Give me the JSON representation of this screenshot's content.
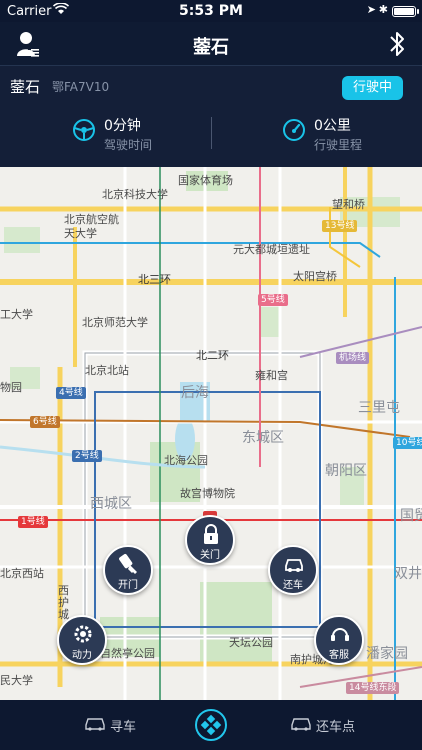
{
  "status": {
    "carrier": "Carrier",
    "time": "5:53 PM"
  },
  "nav": {
    "title": "蓥石"
  },
  "info": {
    "car_name": "蓥石",
    "plate": "鄂FA7V10",
    "drive_button": "行驶中",
    "drive_time": {
      "value": "0分钟",
      "label": "驾驶时间"
    },
    "mileage": {
      "value": "0公里",
      "label": "行驶里程"
    }
  },
  "map": {
    "labels": [
      "国家体育场",
      "北京科技大学",
      "望和桥",
      "北京航空航天大学",
      "元大都城垣遗址",
      "13号线",
      "北三环",
      "太阳宫桥",
      "北京师范大学",
      "5号线",
      "工大学",
      "北二环",
      "机场线",
      "北京北站",
      "雍和宫",
      "后海",
      "4号线",
      "物园",
      "三里屯",
      "6号线",
      "东城区",
      "10号线",
      "2号线",
      "北海公园",
      "朝阳区",
      "故宫博物院",
      "西城区",
      "国贸",
      "1号线",
      "北京西站",
      "双井",
      "天坛公园",
      "自然亭公园",
      "潘家园",
      "南护城河",
      "14号线东段",
      "民大学",
      "西护城"
    ],
    "accent": "#19c3e8"
  },
  "actions": {
    "unlock": "开门",
    "lock": "关门",
    "return_car": "还车",
    "power": "动力",
    "service": "客服"
  },
  "tabs": {
    "find_car": "寻车",
    "return_point": "还车点"
  }
}
